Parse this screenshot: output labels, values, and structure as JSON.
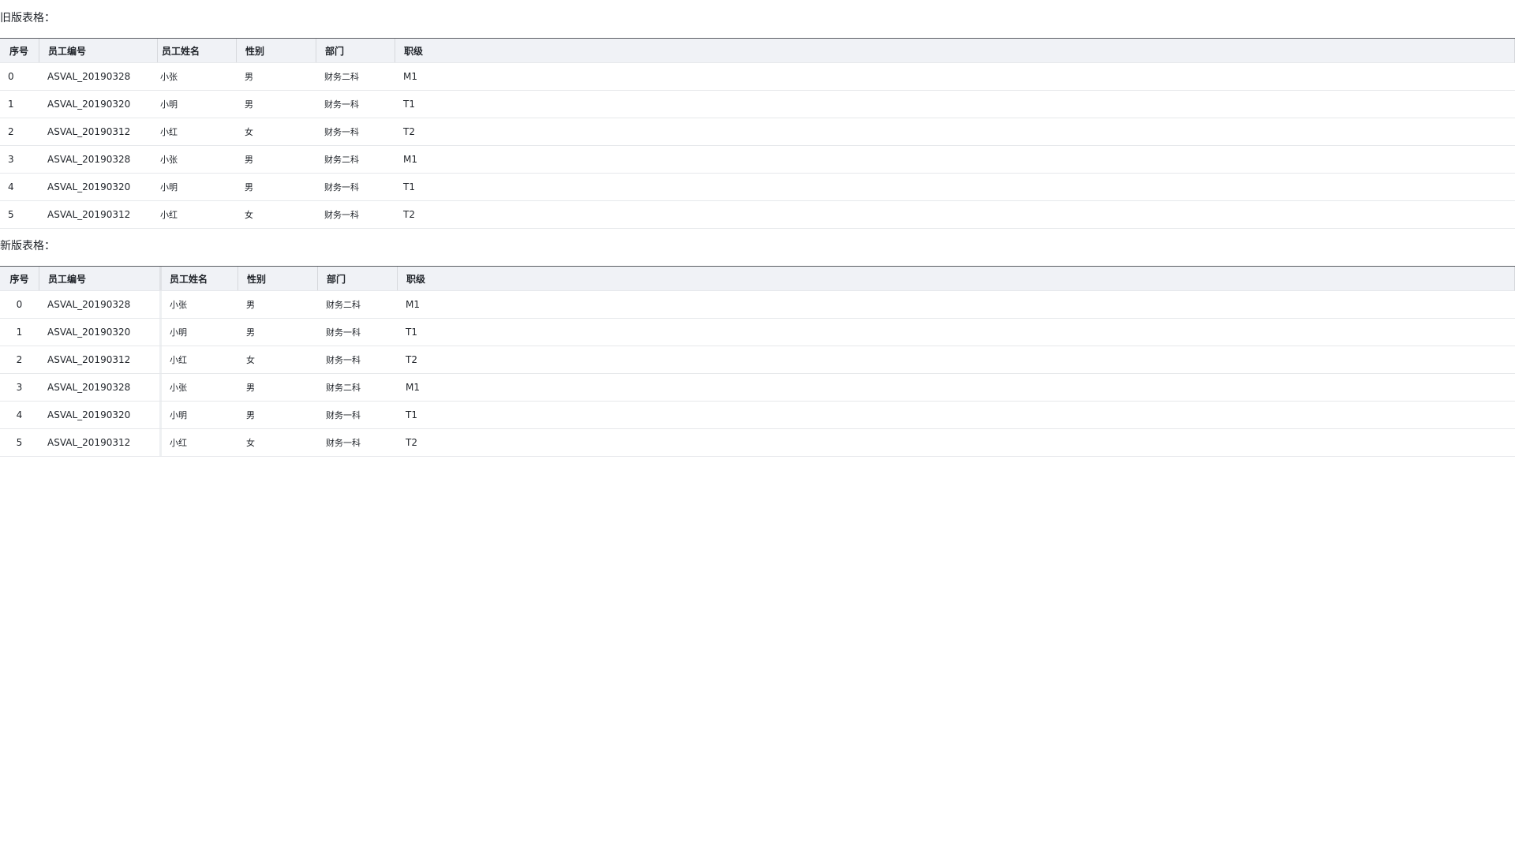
{
  "old_section": {
    "title": "旧版表格：",
    "columns": [
      "序号",
      "员工编号",
      "员工姓名",
      "性别",
      "部门",
      "职级"
    ],
    "rows": [
      [
        "0",
        "ASVAL_20190328",
        "小张",
        "男",
        "财务二科",
        "M1"
      ],
      [
        "1",
        "ASVAL_20190320",
        "小明",
        "男",
        "财务一科",
        "T1"
      ],
      [
        "2",
        "ASVAL_20190312",
        "小红",
        "女",
        "财务一科",
        "T2"
      ],
      [
        "3",
        "ASVAL_20190328",
        "小张",
        "男",
        "财务二科",
        "M1"
      ],
      [
        "4",
        "ASVAL_20190320",
        "小明",
        "男",
        "财务一科",
        "T1"
      ],
      [
        "5",
        "ASVAL_20190312",
        "小红",
        "女",
        "财务一科",
        "T2"
      ]
    ]
  },
  "new_section": {
    "title": "新版表格：",
    "columns": [
      "序号",
      "员工编号",
      "员工姓名",
      "性别",
      "部门",
      "职级"
    ],
    "rows": [
      [
        "0",
        "ASVAL_20190328",
        "小张",
        "男",
        "财务二科",
        "M1"
      ],
      [
        "1",
        "ASVAL_20190320",
        "小明",
        "男",
        "财务一科",
        "T1"
      ],
      [
        "2",
        "ASVAL_20190312",
        "小红",
        "女",
        "财务一科",
        "T2"
      ],
      [
        "3",
        "ASVAL_20190328",
        "小张",
        "男",
        "财务二科",
        "M1"
      ],
      [
        "4",
        "ASVAL_20190320",
        "小明",
        "男",
        "财务一科",
        "T1"
      ],
      [
        "5",
        "ASVAL_20190312",
        "小红",
        "女",
        "财务一科",
        "T2"
      ]
    ]
  }
}
